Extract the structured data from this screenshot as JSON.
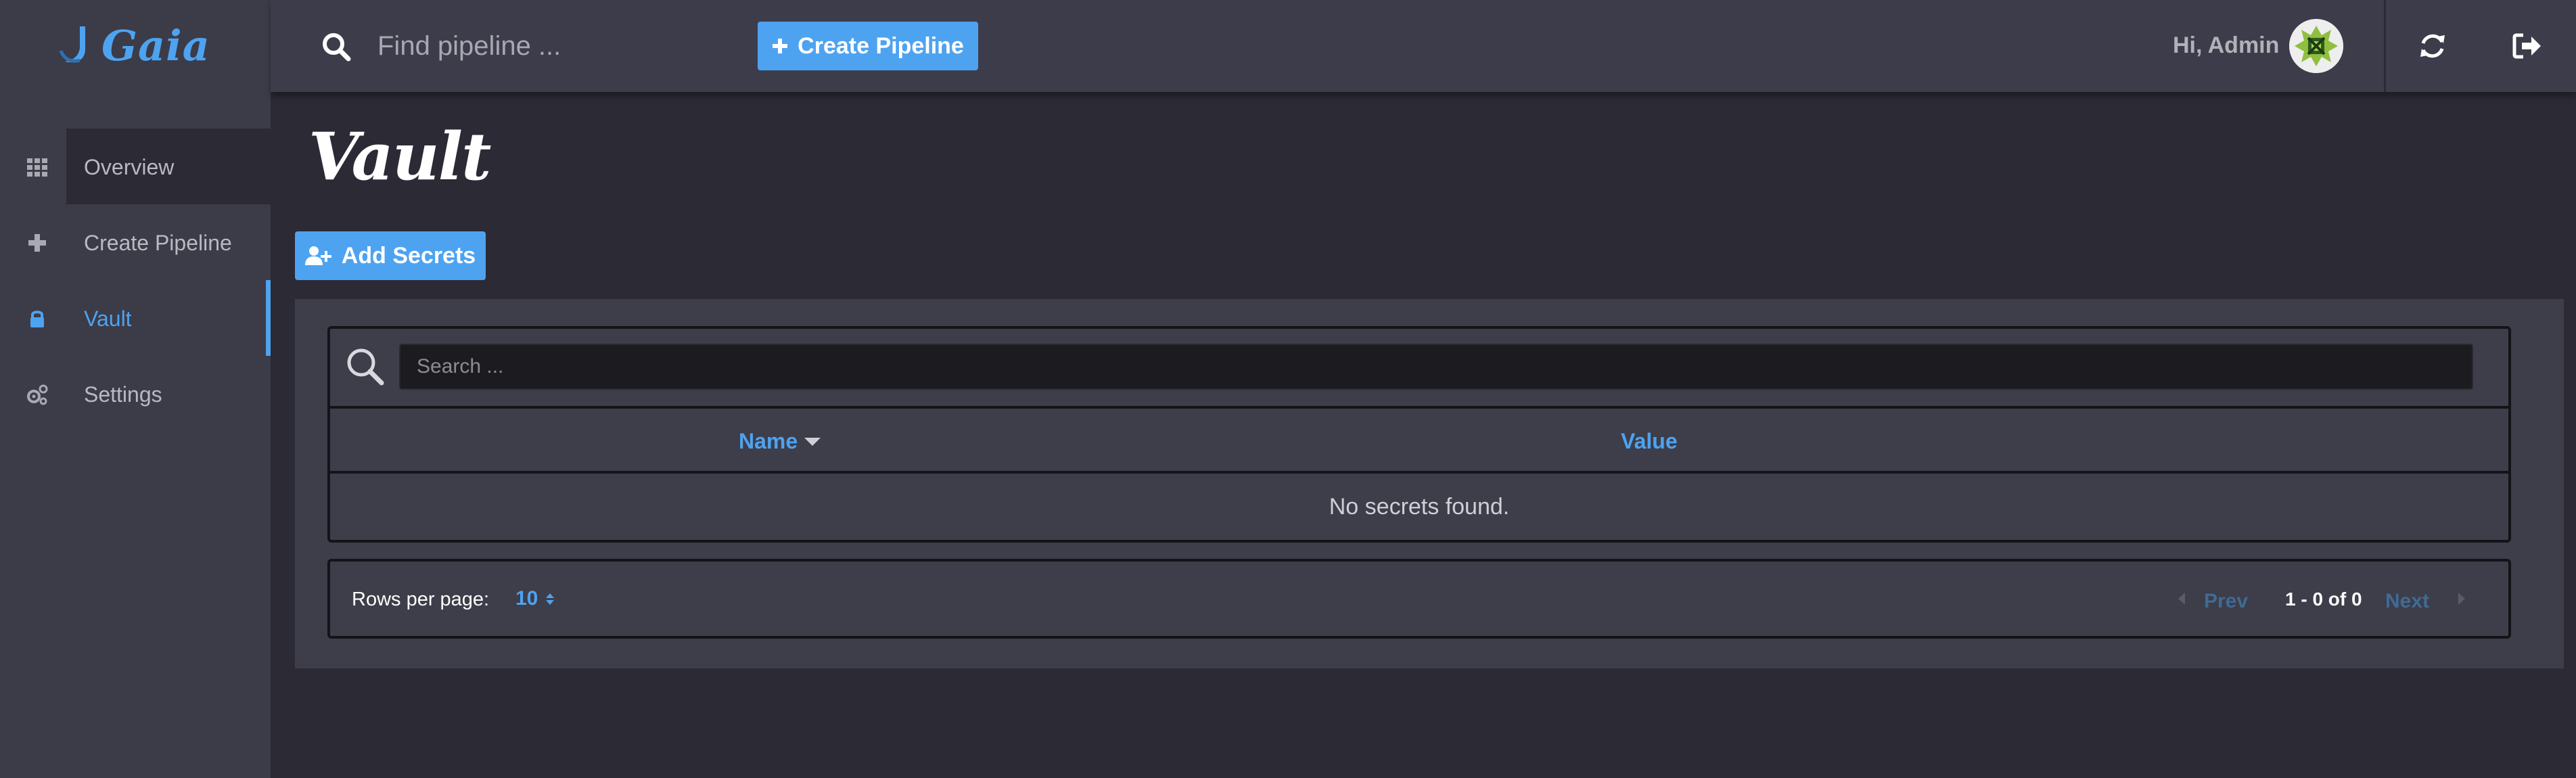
{
  "app": {
    "name": "Gaia"
  },
  "sidebar": {
    "items": [
      {
        "label": "Overview",
        "icon": "grid-icon"
      },
      {
        "label": "Create Pipeline",
        "icon": "plus-icon"
      },
      {
        "label": "Vault",
        "icon": "lock-icon",
        "active": true
      },
      {
        "label": "Settings",
        "icon": "gears-icon"
      }
    ]
  },
  "topbar": {
    "search_placeholder": "Find pipeline ...",
    "create_label": "Create Pipeline",
    "greeting": "Hi, Admin"
  },
  "page": {
    "title": "Vault",
    "add_label": "Add Secrets"
  },
  "table": {
    "search_placeholder": "Search ...",
    "columns": [
      "Name",
      "Value"
    ],
    "sort_column": "Name",
    "empty_text": "No secrets found."
  },
  "pagination": {
    "rows_label": "Rows per page:",
    "rows_value": "10",
    "prev_label": "Prev",
    "range_text": "1 - 0 of 0",
    "next_label": "Next"
  },
  "colors": {
    "accent": "#4da3f0",
    "sidebar_bg": "#3c3b48",
    "page_bg": "#2b2a35",
    "panel_bg": "#3e3d4a"
  }
}
